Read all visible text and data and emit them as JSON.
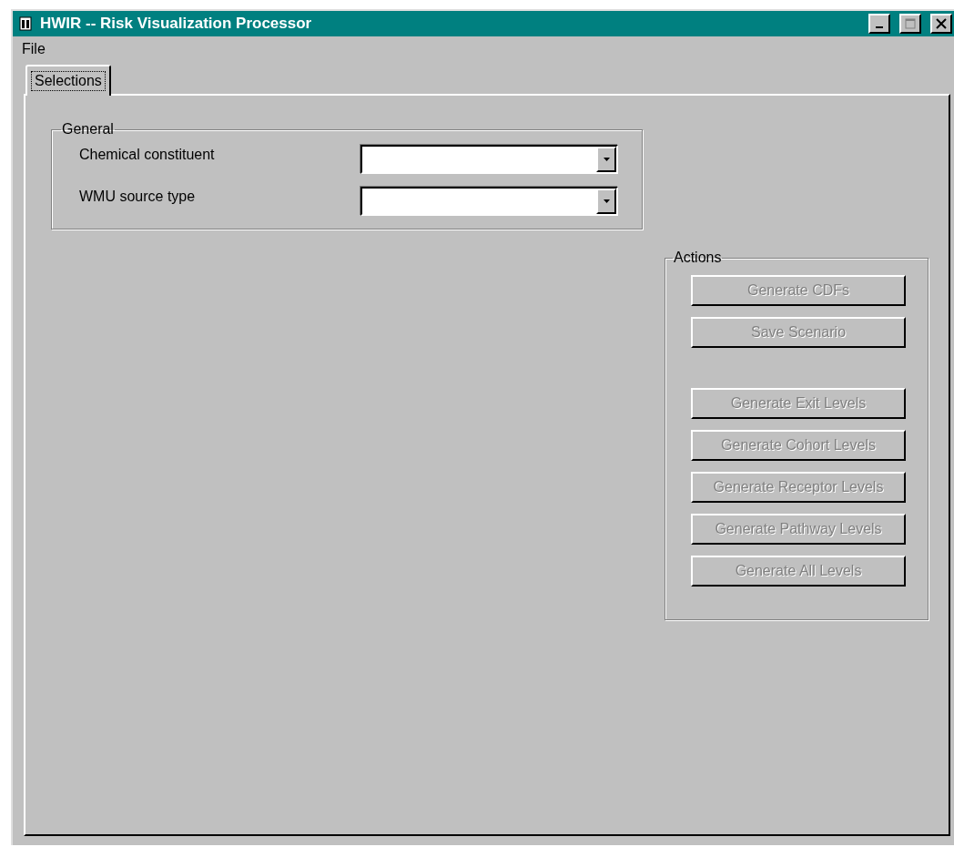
{
  "window": {
    "title": "HWIR -- Risk Visualization Processor",
    "controls": [
      {
        "kind": "minimize",
        "disabled": false
      },
      {
        "kind": "maximize",
        "disabled": true
      },
      {
        "kind": "close",
        "disabled": false
      }
    ]
  },
  "menu": [
    "File"
  ],
  "tabs": [
    {
      "label": "Selections",
      "selected": true
    }
  ],
  "general": {
    "title": "General",
    "fields": [
      {
        "label": "Chemical constituent"
      },
      {
        "label": "WMU source type"
      }
    ]
  },
  "actions": {
    "title": "Actions",
    "groups": [
      [
        {
          "label": "Generate CDFs",
          "disabled": true
        },
        {
          "label": "Save Scenario",
          "disabled": true
        }
      ],
      [
        {
          "label": "Generate Exit Levels",
          "disabled": true
        },
        {
          "label": "Generate Cohort Levels",
          "disabled": true
        },
        {
          "label": "Generate Receptor Levels",
          "disabled": true
        },
        {
          "label": "Generate Pathway Levels",
          "disabled": true
        },
        {
          "label": "Generate All Levels",
          "disabled": true
        }
      ]
    ]
  }
}
